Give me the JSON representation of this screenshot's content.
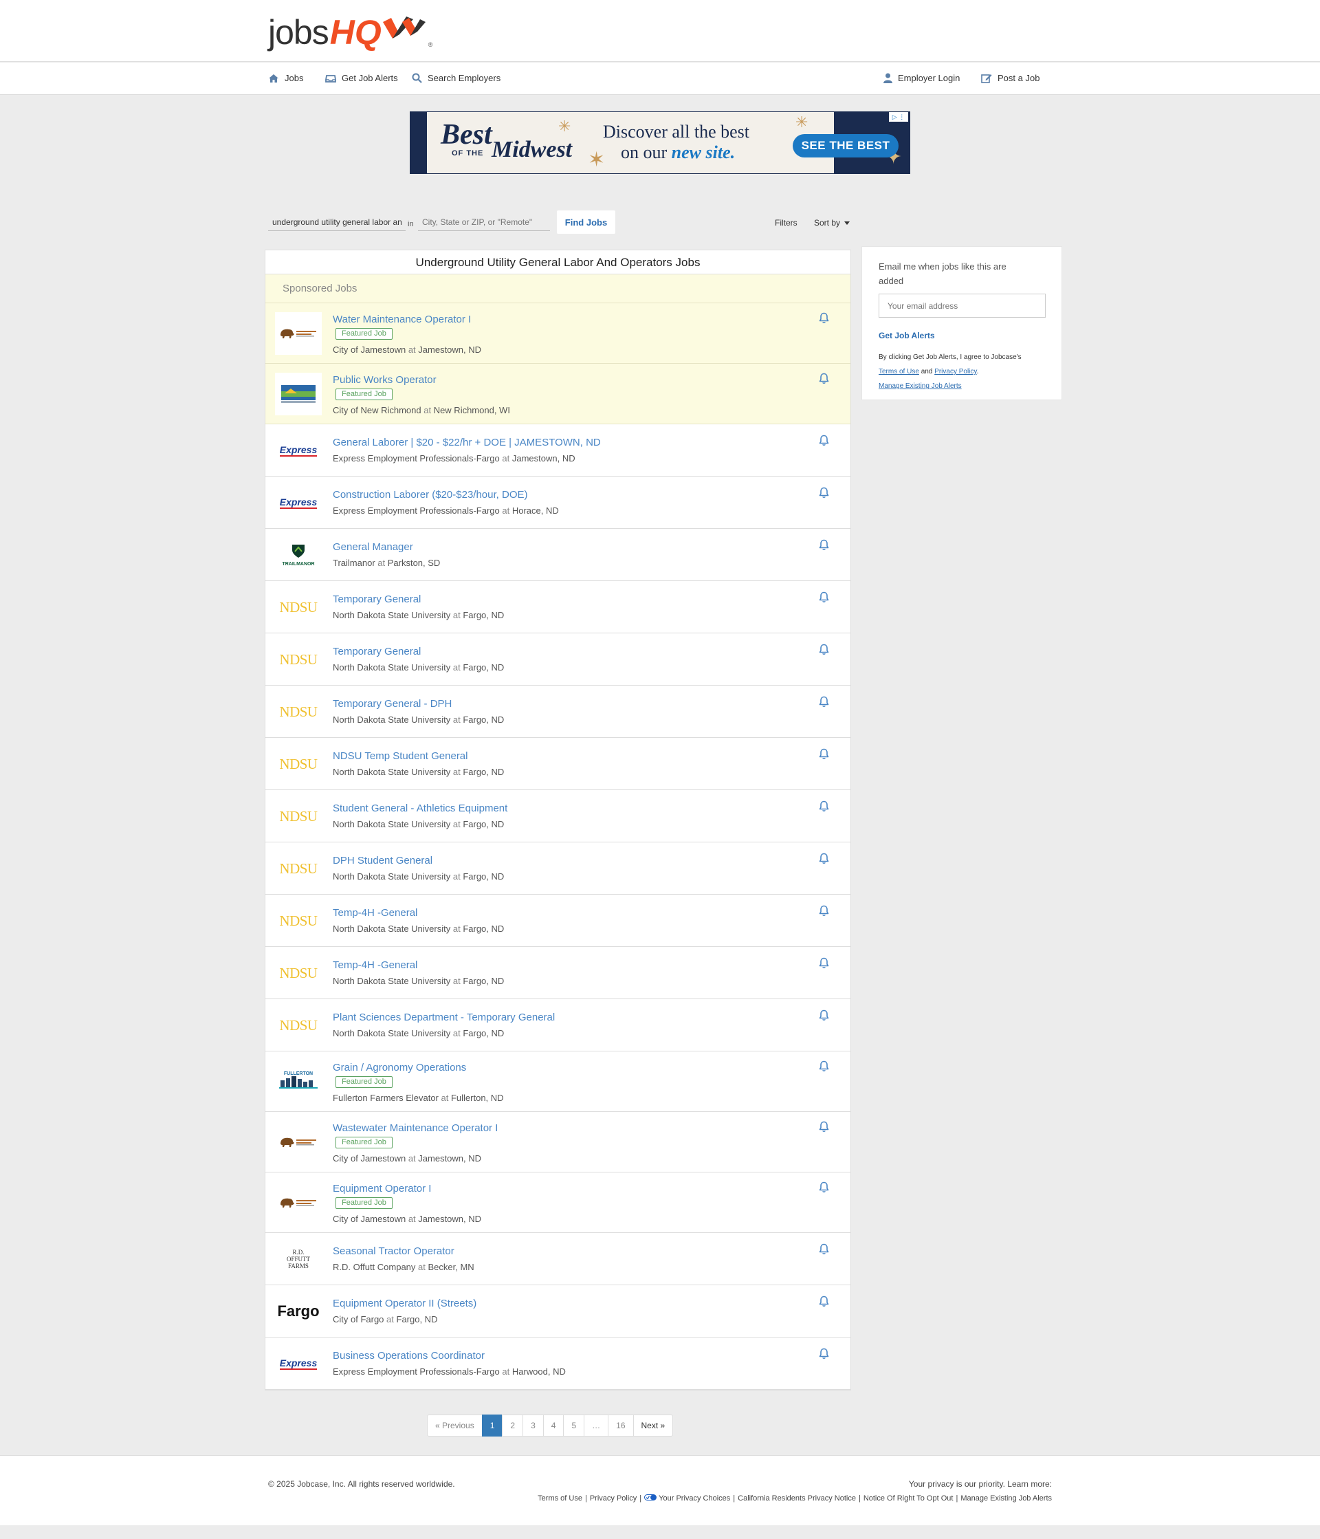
{
  "header": {
    "logo_jobs": "jobs",
    "logo_hq": "HQ",
    "logo_reg": "®"
  },
  "nav": {
    "jobs": "Jobs",
    "alerts": "Get Job Alerts",
    "employers": "Search Employers",
    "employer_login": "Employer Login",
    "post_job": "Post a Job"
  },
  "ad": {
    "brand_best": "Best",
    "brand_of_the": "OF THE",
    "brand_midwest": "Midwest",
    "line1": "Discover all the best",
    "line2_prefix": "on our",
    "line2_emphasis": "new site.",
    "cta": "SEE THE BEST"
  },
  "search": {
    "what_value": "underground utility general labor and",
    "in_label": "in",
    "where_placeholder": "City, State or ZIP, or \"Remote\"",
    "find_button": "Find Jobs",
    "filters": "Filters",
    "sort_by": "Sort by"
  },
  "list": {
    "title": "Underground Utility General Labor And Operators Jobs",
    "sponsored_header": "Sponsored Jobs",
    "at_word": "at",
    "featured_label": "Featured Job"
  },
  "jobs": [
    {
      "title": "Water Maintenance Operator I",
      "company": "City of Jamestown",
      "location": "Jamestown, ND",
      "featured": true,
      "sponsored": true,
      "logo": "jamestown"
    },
    {
      "title": "Public Works Operator",
      "company": "City of New Richmond",
      "location": "New Richmond, WI",
      "featured": true,
      "sponsored": true,
      "logo": "newrichmond"
    },
    {
      "title": "General Laborer | $20 - $22/hr + DOE | JAMESTOWN, ND",
      "company": "Express Employment Professionals-Fargo",
      "location": "Jamestown, ND",
      "featured": false,
      "sponsored": false,
      "logo": "express"
    },
    {
      "title": "Construction Laborer ($20-$23/hour, DOE)",
      "company": "Express Employment Professionals-Fargo",
      "location": "Horace, ND",
      "featured": false,
      "sponsored": false,
      "logo": "express"
    },
    {
      "title": "General Manager",
      "company": "Trailmanor",
      "location": "Parkston, SD",
      "featured": false,
      "sponsored": false,
      "logo": "trailmanor"
    },
    {
      "title": "Temporary General",
      "company": "North Dakota State University",
      "location": "Fargo, ND",
      "featured": false,
      "sponsored": false,
      "logo": "ndsu"
    },
    {
      "title": "Temporary General",
      "company": "North Dakota State University",
      "location": "Fargo, ND",
      "featured": false,
      "sponsored": false,
      "logo": "ndsu"
    },
    {
      "title": "Temporary General - DPH",
      "company": "North Dakota State University",
      "location": "Fargo, ND",
      "featured": false,
      "sponsored": false,
      "logo": "ndsu"
    },
    {
      "title": "NDSU Temp Student General",
      "company": "North Dakota State University",
      "location": "Fargo, ND",
      "featured": false,
      "sponsored": false,
      "logo": "ndsu"
    },
    {
      "title": "Student General - Athletics Equipment",
      "company": "North Dakota State University",
      "location": "Fargo, ND",
      "featured": false,
      "sponsored": false,
      "logo": "ndsu"
    },
    {
      "title": "DPH Student General",
      "company": "North Dakota State University",
      "location": "Fargo, ND",
      "featured": false,
      "sponsored": false,
      "logo": "ndsu"
    },
    {
      "title": "Temp-4H -General",
      "company": "North Dakota State University",
      "location": "Fargo, ND",
      "featured": false,
      "sponsored": false,
      "logo": "ndsu"
    },
    {
      "title": "Temp-4H -General",
      "company": "North Dakota State University",
      "location": "Fargo, ND",
      "featured": false,
      "sponsored": false,
      "logo": "ndsu"
    },
    {
      "title": "Plant Sciences Department - Temporary General",
      "company": "North Dakota State University",
      "location": "Fargo, ND",
      "featured": false,
      "sponsored": false,
      "logo": "ndsu"
    },
    {
      "title": "Grain / Agronomy Operations",
      "company": "Fullerton Farmers Elevator",
      "location": "Fullerton, ND",
      "featured": true,
      "sponsored": false,
      "logo": "fullerton"
    },
    {
      "title": "Wastewater Maintenance Operator I",
      "company": "City of Jamestown",
      "location": "Jamestown, ND",
      "featured": true,
      "sponsored": false,
      "logo": "jamestown"
    },
    {
      "title": "Equipment Operator I",
      "company": "City of Jamestown",
      "location": "Jamestown, ND",
      "featured": true,
      "sponsored": false,
      "logo": "jamestown"
    },
    {
      "title": "Seasonal Tractor Operator",
      "company": "R.D. Offutt Company",
      "location": "Becker, MN",
      "featured": false,
      "sponsored": false,
      "logo": "offutt"
    },
    {
      "title": "Equipment Operator II (Streets)",
      "company": "City of Fargo",
      "location": "Fargo, ND",
      "featured": false,
      "sponsored": false,
      "logo": "fargo"
    },
    {
      "title": "Business Operations Coordinator",
      "company": "Express Employment Professionals-Fargo",
      "location": "Harwood, ND",
      "featured": false,
      "sponsored": false,
      "logo": "express"
    }
  ],
  "logo_text": {
    "ndsu": "NDSU",
    "express": "Express",
    "fargo": "Fargo",
    "offutt": "R.D. OFFUTT FARMS",
    "trailmanor": "TRAILMANOR",
    "fullerton": "FULLERTON"
  },
  "pagination": {
    "prev": "« Previous",
    "pages": [
      "1",
      "2",
      "3",
      "4",
      "5",
      "…",
      "16"
    ],
    "active": "1",
    "next": "Next »"
  },
  "sidebar": {
    "label": "Email me when jobs like this are added",
    "email_placeholder": "Your email address",
    "button": "Get Job Alerts",
    "terms_prefix": "By clicking Get Job Alerts, I agree to Jobcase's",
    "terms_of_use": "Terms of Use",
    "and_word": "and",
    "privacy_policy": "Privacy Policy",
    "manage": "Manage Existing Job Alerts"
  },
  "footer": {
    "copyright": "© 2025 Jobcase, Inc. All rights reserved worldwide.",
    "privacy_note": "Your privacy is our priority. Learn more:",
    "links": [
      "Terms of Use",
      "Privacy Policy",
      "Your Privacy Choices",
      "California Residents Privacy Notice",
      "Notice Of Right To Opt Out",
      "Manage Existing Job Alerts"
    ]
  },
  "colors": {
    "brand_orange": "#f04e23",
    "link_blue": "#4a86c5",
    "featured_green": "#5ba360",
    "sponsored_bg": "#fcfbe0",
    "active_page": "#337ab7"
  }
}
